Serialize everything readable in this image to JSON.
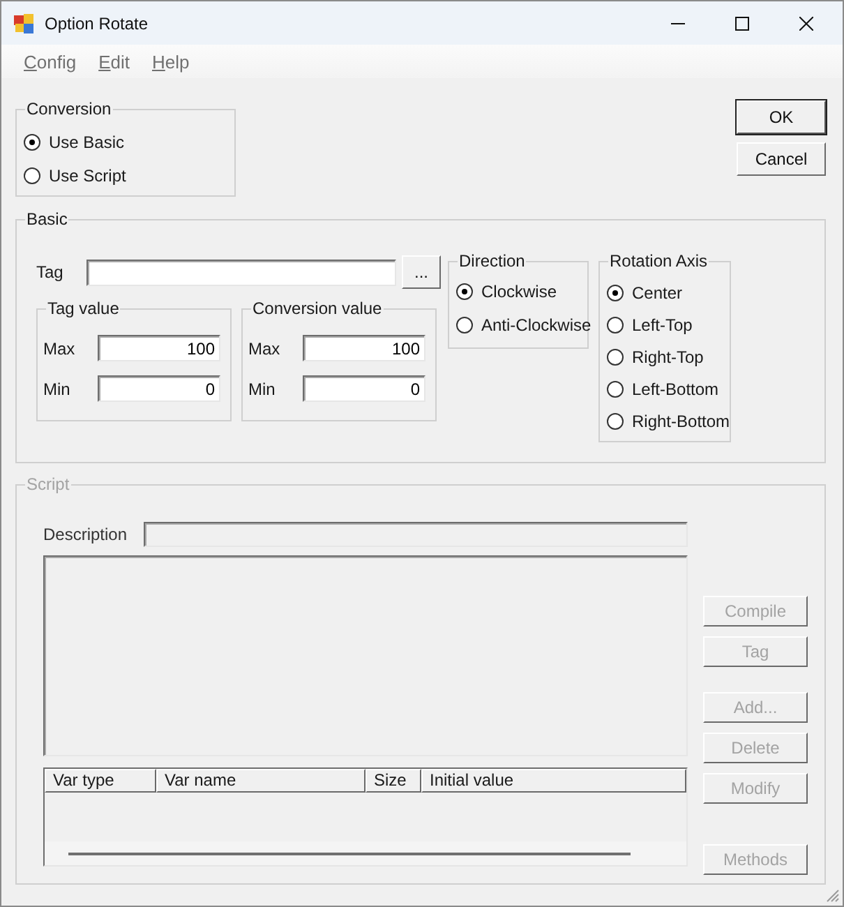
{
  "window": {
    "title": "Option Rotate"
  },
  "menu": [
    {
      "label": "Config"
    },
    {
      "label": "Edit"
    },
    {
      "label": "Help"
    }
  ],
  "conversion": {
    "title": "Conversion",
    "options": [
      {
        "label": "Use Basic",
        "selected": true
      },
      {
        "label": "Use Script",
        "selected": false
      }
    ]
  },
  "dialog_buttons": [
    {
      "label": "OK",
      "default": true
    },
    {
      "label": "Cancel",
      "default": false
    }
  ],
  "basic": {
    "title": "Basic",
    "tag": {
      "label": "Tag"
    },
    "browse_button": "...",
    "value_groups": [
      {
        "title": "Tag value",
        "fields": [
          {
            "label": "Max",
            "value": "100"
          },
          {
            "label": "Min",
            "value": "0"
          }
        ]
      },
      {
        "title": "Conversion value",
        "fields": [
          {
            "label": "Max",
            "value": "100"
          },
          {
            "label": "Min",
            "value": "0"
          }
        ]
      }
    ],
    "direction": {
      "title": "Direction",
      "options": [
        {
          "label": "Clockwise",
          "selected": true
        },
        {
          "label": "Anti-Clockwise",
          "selected": false
        }
      ]
    },
    "rotation_axis": {
      "title": "Rotation Axis",
      "options": [
        {
          "label": "Center",
          "selected": true
        },
        {
          "label": "Left-Top",
          "selected": false
        },
        {
          "label": "Right-Top",
          "selected": false
        },
        {
          "label": "Left-Bottom",
          "selected": false
        },
        {
          "label": "Right-Bottom",
          "selected": false
        }
      ]
    }
  },
  "script": {
    "title": "Script",
    "disabled": true,
    "description": {
      "label": "Description"
    },
    "columns": [
      "Var type",
      "Var name",
      "Size",
      "Initial value"
    ],
    "button_groups": [
      [
        {
          "label": "Compile",
          "disabled": true
        },
        {
          "label": "Tag",
          "disabled": true
        }
      ],
      [
        {
          "label": "Add...",
          "disabled": true
        },
        {
          "label": "Delete",
          "disabled": true
        },
        {
          "label": "Modify",
          "disabled": true
        }
      ],
      [
        {
          "label": "Methods",
          "disabled": true
        }
      ]
    ]
  }
}
